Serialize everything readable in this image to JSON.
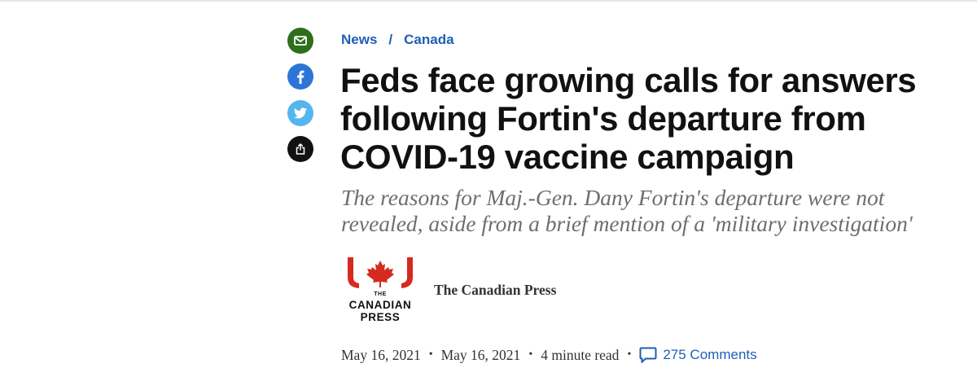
{
  "breadcrumb": {
    "items": [
      "News",
      "Canada"
    ],
    "separator": "/"
  },
  "share": {
    "icons": [
      "email-icon",
      "facebook-icon",
      "twitter-icon",
      "share-icon"
    ],
    "colors": {
      "email": "#2f6e1c",
      "facebook": "#2d74d7",
      "twitter": "#55b5ef",
      "share": "#111111"
    }
  },
  "article": {
    "headline": "Feds face growing calls for answers following Fortin's departure from COVID-19 vaccine campaign",
    "deck": "The reasons for Maj.-Gen. Dany Fortin's departure were not revealed, aside from a brief mention of a 'military investigation'"
  },
  "author": {
    "name": "The Canadian Press",
    "logo": {
      "small": "THE",
      "line1": "CANADIAN",
      "line2": "PRESS",
      "accent": "#d52b1e"
    }
  },
  "meta": {
    "published": "May 16, 2021",
    "updated": "May 16, 2021",
    "read_time": "4 minute read",
    "comments": "275 Comments",
    "separator": "•"
  },
  "colors": {
    "link": "#1f5fb5",
    "deck": "#6e6e6e"
  }
}
